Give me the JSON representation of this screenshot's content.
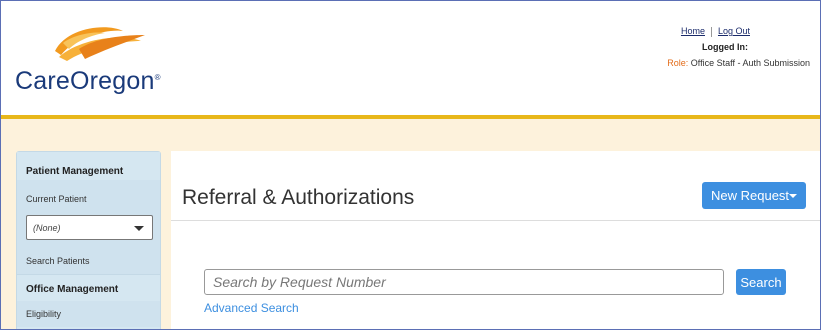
{
  "header": {
    "brand_name": "CareOregon",
    "brand_mark": "®",
    "links": {
      "home": "Home",
      "logout": "Log Out"
    },
    "logged_in_label": "Logged In:",
    "role_label": "Role:",
    "role_value": "Office Staff - Auth Submission",
    "colors": {
      "brand_blue": "#1a3a7a",
      "logo_orange": "#f29a1f",
      "gold_bar": "#e8b71a",
      "role_orange": "#e36d1b"
    }
  },
  "sidebar": {
    "patient_management": "Patient Management",
    "current_patient": "Current Patient",
    "patient_select_value": "(None)",
    "search_patients": "Search Patients",
    "office_management": "Office Management",
    "eligibility": "Eligibility"
  },
  "main": {
    "title": "Referral & Authorizations",
    "new_request_label": "New Request",
    "search_placeholder": "Search by Request Number",
    "search_button": "Search",
    "advanced_search": "Advanced Search",
    "accent": "#3d8fe0"
  }
}
